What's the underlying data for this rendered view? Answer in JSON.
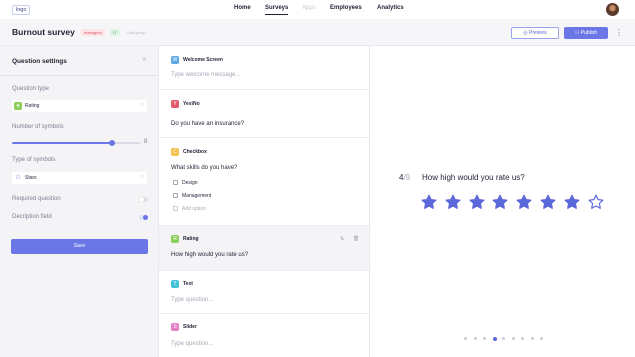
{
  "brand": {
    "logo": "logo",
    "accent": "#6b77e6"
  },
  "nav": {
    "items": [
      {
        "label": "Home",
        "state": "normal"
      },
      {
        "label": "Surveys",
        "state": "active"
      },
      {
        "label": "Apps",
        "state": "disabled"
      },
      {
        "label": "Employees",
        "state": "normal"
      },
      {
        "label": "Analytics",
        "state": "normal"
      }
    ],
    "avatar": "user-avatar"
  },
  "header": {
    "title": "Burnout survey",
    "tags": [
      "managers",
      "IT"
    ],
    "add_group": "Add group",
    "preview_label": "Preview",
    "publish_label": "Publish",
    "more": "⋮"
  },
  "settings": {
    "title": "Question settings",
    "question_type_label": "Question type",
    "question_type_value": "Rating",
    "num_symbols_label": "Number of symbols",
    "num_symbols_value": "8",
    "num_symbols_fraction": 0.78,
    "type_symbols_label": "Type of symbols",
    "type_symbols_value": "Stars",
    "required_label": "Required question",
    "required_on": false,
    "description_label": "Decription field",
    "description_on": true,
    "save_label": "Save"
  },
  "questions": [
    {
      "type": "Welcome Screen",
      "icon": "W",
      "icon_color": "#5aa8e6",
      "text": "Type welcome message...",
      "placeholder": true
    },
    {
      "type": "Yes\\No",
      "icon": "Y",
      "icon_color": "#e05a6a",
      "text": "Do you have an insurance?",
      "placeholder": false
    },
    {
      "type": "Checkbox",
      "icon": "C",
      "icon_color": "#f2c14e",
      "text": "What skills do you have?",
      "placeholder": false,
      "options": [
        "Design",
        "Management"
      ],
      "add_option": "Add option"
    },
    {
      "type": "Rating",
      "icon": "R",
      "icon_color": "#8ccd5c",
      "text": "How high would you rate us?",
      "placeholder": false,
      "active": true
    },
    {
      "type": "Text",
      "icon": "T",
      "icon_color": "#45c3d6",
      "text": "Type question...",
      "placeholder": true
    },
    {
      "type": "Slider",
      "icon": "S",
      "icon_color": "#e27fc6",
      "text": "Type question...",
      "placeholder": true
    }
  ],
  "preview": {
    "current": "4",
    "total": "/9",
    "question": "How high would you rate us?",
    "stars_total": 8,
    "stars_filled": 7,
    "star_color": "#5b68d9",
    "pagination_total": 9,
    "pagination_current": 4
  }
}
